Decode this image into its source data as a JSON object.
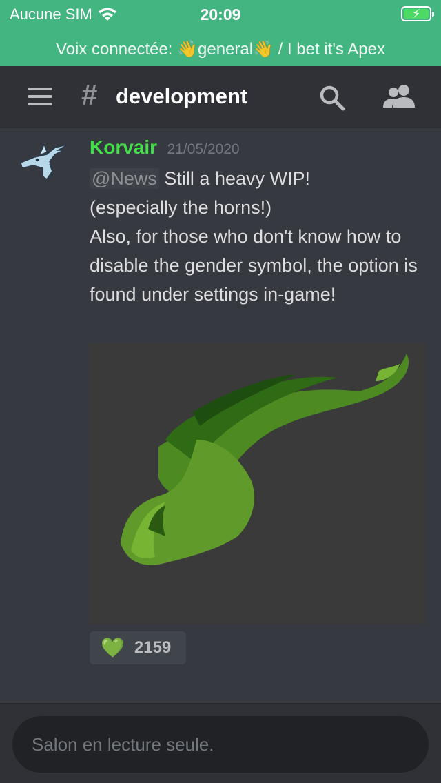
{
  "status_bar": {
    "carrier": "Aucune SIM",
    "time": "20:09"
  },
  "voice_banner": {
    "text": "Voix connectée: 👋general👋 / I bet it's Apex"
  },
  "header": {
    "hash": "#",
    "channel_name": "development"
  },
  "message": {
    "author": "Korvair",
    "timestamp": "21/05/2020",
    "mention": "@News",
    "line1": " Still a heavy WIP!",
    "line2": "(especially the horns!)",
    "line3": "Also, for those who don't know how to disable the gender symbol, the option is found under settings in-game!",
    "reaction": {
      "emoji": "💚",
      "count": "2159"
    }
  },
  "input": {
    "placeholder": "Salon en lecture seule."
  },
  "colors": {
    "banner_green": "#43b581",
    "author_green": "#43e04a",
    "background": "#36393f"
  }
}
